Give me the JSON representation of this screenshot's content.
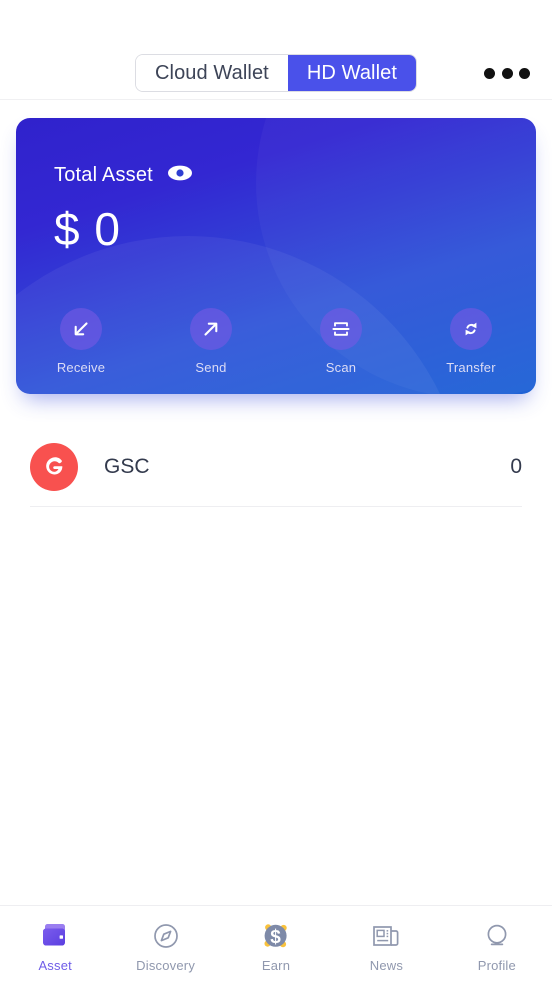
{
  "header": {
    "tabs": [
      {
        "label": "Cloud Wallet",
        "active": false
      },
      {
        "label": "HD Wallet",
        "active": true
      }
    ],
    "menu_icon": "more-horizontal-icon"
  },
  "asset_card": {
    "total_label": "Total Asset",
    "eye_icon": "eye-visible-icon",
    "currency_symbol": "$",
    "amount": "0",
    "amount_display": "$ 0",
    "gradient_from": "#3022cc",
    "gradient_to": "#1f63d6",
    "actions": [
      {
        "label": "Receive",
        "icon": "arrow-down-left-icon"
      },
      {
        "label": "Send",
        "icon": "arrow-up-right-icon"
      },
      {
        "label": "Scan",
        "icon": "qr-scan-icon"
      },
      {
        "label": "Transfer",
        "icon": "swap-refresh-icon"
      }
    ]
  },
  "tokens": [
    {
      "symbol": "GSC",
      "balance": "0",
      "logo_color": "#f8514f",
      "logo_icon": "gsc-logo-icon"
    }
  ],
  "bottom_nav": {
    "active_color": "#6f5de8",
    "inactive_color": "#9098ae",
    "items": [
      {
        "label": "Asset",
        "icon": "wallet-icon",
        "active": true
      },
      {
        "label": "Discovery",
        "icon": "compass-icon",
        "active": false
      },
      {
        "label": "Earn",
        "icon": "dollar-coin-icon",
        "active": false
      },
      {
        "label": "News",
        "icon": "newspaper-icon",
        "active": false
      },
      {
        "label": "Profile",
        "icon": "person-circle-icon",
        "active": false
      }
    ]
  }
}
